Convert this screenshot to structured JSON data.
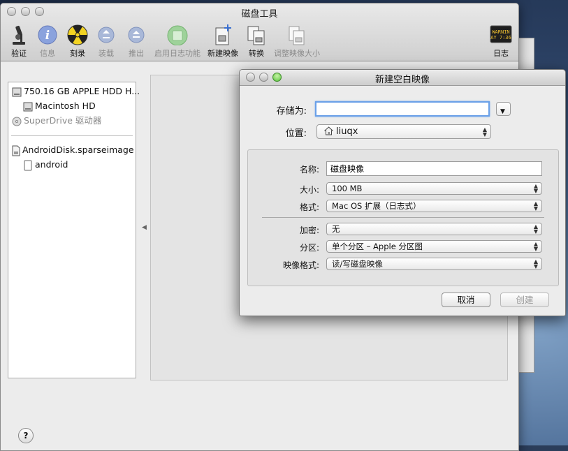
{
  "main_window": {
    "title": "磁盘工具",
    "toolbar": {
      "verify": "验证",
      "info": "信息",
      "burn": "刻录",
      "mount": "装载",
      "eject": "推出",
      "enable_journaling": "启用日志功能",
      "new_image": "新建映像",
      "convert": "转换",
      "resize_image": "调整映像大小",
      "log": "日志",
      "log_icon_text_1": "WARNIN",
      "log_icon_text_2": "AY 7:36"
    },
    "sidebar": {
      "items": [
        {
          "label": "750.16 GB APPLE HDD H...",
          "icon": "hard-disk-icon"
        },
        {
          "label": "Macintosh HD",
          "icon": "volume-icon"
        },
        {
          "label": "SuperDrive 驱动器",
          "icon": "optical-drive-icon"
        },
        {
          "label": "AndroidDisk.sparseimage",
          "icon": "disk-image-icon"
        },
        {
          "label": "android",
          "icon": "volume-icon"
        }
      ]
    },
    "help_label": "?"
  },
  "sheet": {
    "title": "新建空白映像",
    "save_as_label": "存储为:",
    "save_as_value": "",
    "location_label": "位置:",
    "location_value": "liuqx",
    "name_label": "名称:",
    "name_value": "磁盘映像",
    "size_label": "大小:",
    "size_value": "100 MB",
    "format_label": "格式:",
    "format_value": "Mac OS 扩展（日志式）",
    "encryption_label": "加密:",
    "encryption_value": "无",
    "partitions_label": "分区:",
    "partitions_value": "单个分区 – Apple 分区图",
    "image_format_label": "映像格式:",
    "image_format_value": "读/写磁盘映像",
    "cancel_label": "取消",
    "create_label": "创建"
  },
  "colors": {
    "focus_ring": "#6aa0e8",
    "title_green": "#59c43d",
    "info_blue": "#6d8fe0"
  }
}
